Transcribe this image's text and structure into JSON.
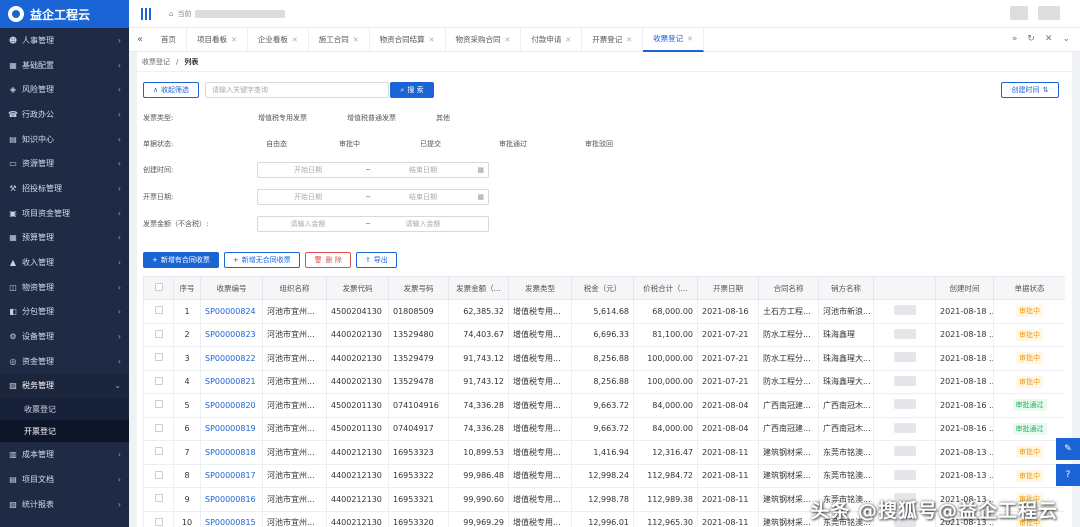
{
  "app": {
    "name": "益企工程云"
  },
  "topbar": {
    "current_prefix": "当前"
  },
  "sidebar": {
    "items": [
      {
        "label": "人事管理",
        "icon": "person-icon"
      },
      {
        "label": "基础配置",
        "icon": "grid-icon"
      },
      {
        "label": "风险管理",
        "icon": "shield-icon"
      },
      {
        "label": "行政办公",
        "icon": "phone-icon"
      },
      {
        "label": "知识中心",
        "icon": "book-icon"
      },
      {
        "label": "资源管理",
        "icon": "folder-icon"
      },
      {
        "label": "招投标管理",
        "icon": "gavel-icon"
      },
      {
        "label": "项目资金管理",
        "icon": "wallet-icon"
      },
      {
        "label": "预算管理",
        "icon": "calc-icon"
      },
      {
        "label": "收入管理",
        "icon": "income-icon"
      },
      {
        "label": "物资管理",
        "icon": "box-icon"
      },
      {
        "label": "分包管理",
        "icon": "layers-icon"
      },
      {
        "label": "设备管理",
        "icon": "gear-icon"
      },
      {
        "label": "资金管理",
        "icon": "coin-icon"
      },
      {
        "label": "税务管理",
        "icon": "tax-icon"
      }
    ],
    "sub_items": [
      {
        "label": "收票登记"
      },
      {
        "label": "开票登记"
      }
    ],
    "after_items": [
      {
        "label": "成本管理",
        "icon": "chart-icon"
      },
      {
        "label": "项目文档",
        "icon": "doc-icon"
      },
      {
        "label": "统计报表",
        "icon": "report-icon"
      }
    ]
  },
  "tabs": [
    {
      "label": "首页"
    },
    {
      "label": "项目看板"
    },
    {
      "label": "企业看板"
    },
    {
      "label": "施工合同"
    },
    {
      "label": "物资合同结算"
    },
    {
      "label": "物资采购合同"
    },
    {
      "label": "付款申请"
    },
    {
      "label": "开票登记"
    },
    {
      "label": "收票登记"
    }
  ],
  "breadcrumb": {
    "parent": "收票登记",
    "sep": "/",
    "current": "列表"
  },
  "search": {
    "collapse_label": "收起筛选",
    "placeholder": "请输入关键字查询",
    "button_label": "搜 索",
    "create_time_label": "创建时间"
  },
  "filters": {
    "invoice_type": {
      "label": "发票类型:",
      "options": [
        "增值税专用发票",
        "增值税普通发票",
        "其他"
      ]
    },
    "doc_status": {
      "label": "单据状态:",
      "options": [
        "自由态",
        "审批中",
        "已提交",
        "审批通过",
        "审批驳回"
      ]
    },
    "create_time": {
      "label": "创建时间:",
      "start": "开始日期",
      "sep": "~",
      "end": "结束日期"
    },
    "invoice_date": {
      "label": "开票日期:",
      "start": "开始日期",
      "sep": "~",
      "end": "结束日期"
    },
    "amount": {
      "label": "发票金额（不含税）:",
      "start": "请输入金额",
      "sep": "~",
      "end": "请输入金额"
    }
  },
  "actions": {
    "add_contract": "新增有合同收票",
    "add_no_contract": "新增无合同收票",
    "delete": "删 除",
    "export": "导出"
  },
  "table": {
    "headers": [
      "序号",
      "收票编号",
      "组织名称",
      "发票代码",
      "发票号码",
      "发票金额（...",
      "发票类型",
      "税金（元）",
      "价税合计（...",
      "开票日期",
      "合同名称",
      "销方名称",
      "",
      "创建时间",
      "单据状态"
    ],
    "rows": [
      {
        "no": "1",
        "code": "SP00000824",
        "org": "河池市宜州...",
        "inv_code": "4500204130",
        "inv_no": "01808509",
        "amount": "62,385.32",
        "type": "增值税专用...",
        "tax": "5,614.68",
        "total": "68,000.00",
        "date": "2021-08-16",
        "contract": "土石方工程...",
        "seller": "河池市新浪...",
        "created": "2021-08-18 ...",
        "status": "审批中"
      },
      {
        "no": "2",
        "code": "SP00000823",
        "org": "河池市宜州...",
        "inv_code": "4400202130",
        "inv_no": "13529480",
        "amount": "74,403.67",
        "type": "增值税专用...",
        "tax": "6,696.33",
        "total": "81,100.00",
        "date": "2021-07-21",
        "contract": "防水工程分...",
        "seller": "珠海鑫瑆",
        "created": "2021-08-18 ...",
        "status": "审批中"
      },
      {
        "no": "3",
        "code": "SP00000822",
        "org": "河池市宜州...",
        "inv_code": "4400202130",
        "inv_no": "13529479",
        "amount": "91,743.12",
        "type": "增值税专用...",
        "tax": "8,256.88",
        "total": "100,000.00",
        "date": "2021-07-21",
        "contract": "防水工程分...",
        "seller": "珠海鑫瑆大...",
        "created": "2021-08-18 ...",
        "status": "审批中"
      },
      {
        "no": "4",
        "code": "SP00000821",
        "org": "河池市宜州...",
        "inv_code": "4400202130",
        "inv_no": "13529478",
        "amount": "91,743.12",
        "type": "增值税专用...",
        "tax": "8,256.88",
        "total": "100,000.00",
        "date": "2021-07-21",
        "contract": "防水工程分...",
        "seller": "珠海鑫瑆大...",
        "created": "2021-08-18 ...",
        "status": "审批中"
      },
      {
        "no": "5",
        "code": "SP00000820",
        "org": "河池市宜州...",
        "inv_code": "4500201130",
        "inv_no": "074104916",
        "amount": "74,336.28",
        "type": "增值税专用...",
        "tax": "9,663.72",
        "total": "84,000.00",
        "date": "2021-08-04",
        "contract": "广西南冠建...",
        "seller": "广西南冠木...",
        "created": "2021-08-16 ...",
        "status": "审批通过"
      },
      {
        "no": "6",
        "code": "SP00000819",
        "org": "河池市宜州...",
        "inv_code": "4500201130",
        "inv_no": "07404917",
        "amount": "74,336.28",
        "type": "增值税专用...",
        "tax": "9,663.72",
        "total": "84,000.00",
        "date": "2021-08-04",
        "contract": "广西南冠建...",
        "seller": "广西南冠木...",
        "created": "2021-08-16 ...",
        "status": "审批通过"
      },
      {
        "no": "7",
        "code": "SP00000818",
        "org": "河池市宜州...",
        "inv_code": "4400212130",
        "inv_no": "16953323",
        "amount": "10,899.53",
        "type": "增值税专用...",
        "tax": "1,416.94",
        "total": "12,316.47",
        "date": "2021-08-11",
        "contract": "建筑钢材采...",
        "seller": "东莞市铭澳...",
        "created": "2021-08-13 ...",
        "status": "审批中"
      },
      {
        "no": "8",
        "code": "SP00000817",
        "org": "河池市宜州...",
        "inv_code": "4400212130",
        "inv_no": "16953322",
        "amount": "99,986.48",
        "type": "增值税专用...",
        "tax": "12,998.24",
        "total": "112,984.72",
        "date": "2021-08-11",
        "contract": "建筑钢材采...",
        "seller": "东莞市铭澳...",
        "created": "2021-08-13 ...",
        "status": "审批中"
      },
      {
        "no": "9",
        "code": "SP00000816",
        "org": "河池市宜州...",
        "inv_code": "4400212130",
        "inv_no": "16953321",
        "amount": "99,990.60",
        "type": "增值税专用...",
        "tax": "12,998.78",
        "total": "112,989.38",
        "date": "2021-08-11",
        "contract": "建筑钢材采...",
        "seller": "东莞市铭澳...",
        "created": "2021-08-13 ...",
        "status": "审批中"
      },
      {
        "no": "10",
        "code": "SP00000815",
        "org": "河池市宜州...",
        "inv_code": "4400212130",
        "inv_no": "16953320",
        "amount": "99,969.29",
        "type": "增值税专用...",
        "tax": "12,996.01",
        "total": "112,965.30",
        "date": "2021-08-11",
        "contract": "建筑钢材采...",
        "seller": "东莞市铭澳...",
        "created": "2021-08-13 ...",
        "status": "审批中"
      }
    ]
  },
  "watermark": "头条 @搜狐号@益企工程云",
  "colors": {
    "brand": "#1a64d6",
    "sidebar_bg": "#1f2b45",
    "pending": "#f39c12",
    "passed": "#27ae60"
  }
}
